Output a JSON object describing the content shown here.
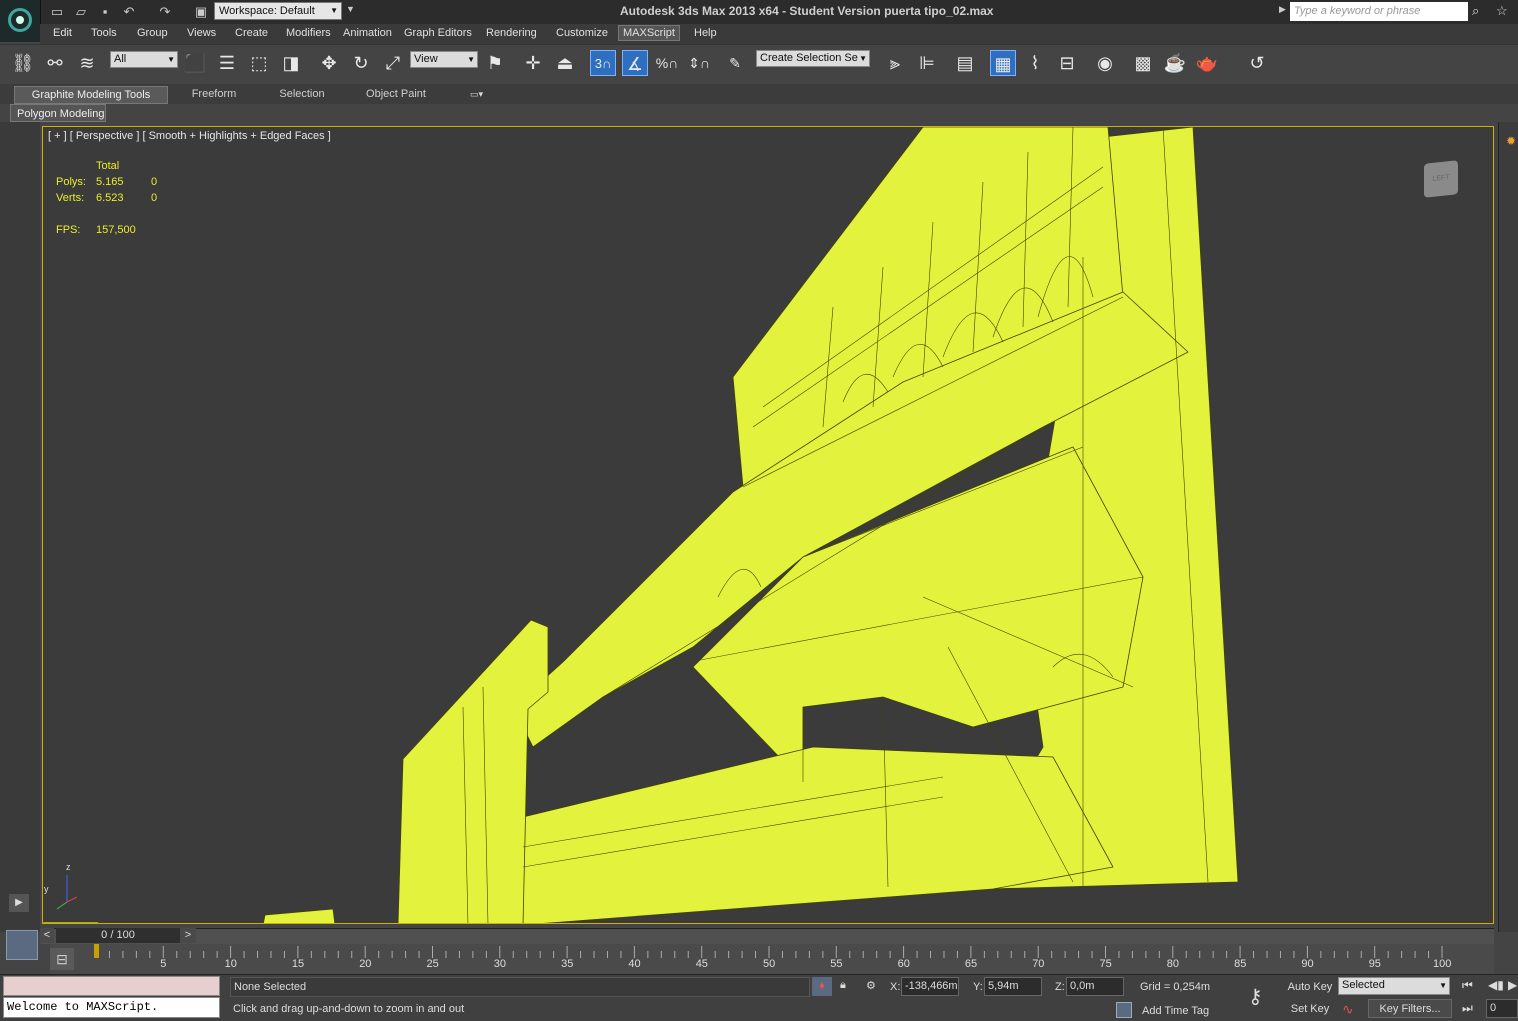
{
  "app": {
    "title": "Autodesk 3ds Max  2013 x64  - Student Version    puerta tipo_02.max",
    "workspace": "Workspace: Default",
    "search_placeholder": "Type a keyword or phrase"
  },
  "menus": [
    "Edit",
    "Tools",
    "Group",
    "Views",
    "Create",
    "Modifiers",
    "Animation",
    "Graph Editors",
    "Rendering",
    "Customize",
    "MAXScript",
    "Help"
  ],
  "toolbar": {
    "selection_filter": "All",
    "ref_coord": "View",
    "snap_value": "3",
    "selection_set": "Create Selection Se"
  },
  "ribbon": {
    "tabs": [
      "Graphite Modeling Tools",
      "Freeform",
      "Selection",
      "Object Paint"
    ],
    "panel": "Polygon Modeling"
  },
  "viewport": {
    "label": "[ + ] [ Perspective ] [ Smooth + Highlights + Edged Faces ]",
    "stats_header": "Total",
    "polys_label": "Polys:",
    "polys_total": "5.165",
    "polys_sel": "0",
    "verts_label": "Verts:",
    "verts_total": "6.523",
    "verts_sel": "0",
    "fps_label": "FPS:",
    "fps_value": "157,500",
    "viewcube_label": "LEFT",
    "object_color": "#e3f23c",
    "axis_z": "z",
    "axis_y": "y"
  },
  "timeline": {
    "position": "0 / 100",
    "ticks": [
      "5",
      "10",
      "15",
      "20",
      "25",
      "30",
      "35",
      "40",
      "45",
      "50",
      "55",
      "60",
      "65",
      "70",
      "75",
      "80",
      "85",
      "90",
      "95",
      "100"
    ]
  },
  "status": {
    "maxscript": "Welcome to MAXScript.",
    "selection": "None Selected",
    "prompt": "Click and drag up-and-down to zoom in and out",
    "x_label": "X:",
    "x_value": "-138,466m",
    "y_label": "Y:",
    "y_value": "5,94m",
    "z_label": "Z:",
    "z_value": "0,0m",
    "grid": "Grid = 0,254m",
    "add_time_tag": "Add Time Tag",
    "auto_key": "Auto Key",
    "set_key": "Set Key",
    "selected": "Selected",
    "key_filters": "Key Filters...",
    "frame": "0"
  }
}
